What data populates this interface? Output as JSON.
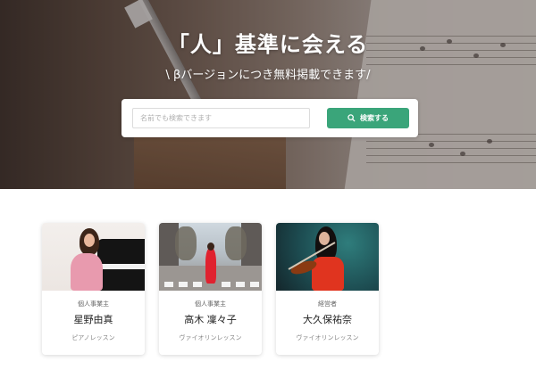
{
  "hero": {
    "title": "「人」基準に会える",
    "subtitle": "\\ βバージョンにつき無料掲載できます/"
  },
  "search": {
    "placeholder": "名前でも検索できます",
    "button_label": "検索する",
    "button_icon": "search-icon",
    "button_color": "#3aa57a"
  },
  "cards": [
    {
      "role": "個人事業主",
      "name": "星野由真",
      "lesson": "ピアノレッスン",
      "photo": "pianist-photo"
    },
    {
      "role": "個人事業主",
      "name": "高木 凜々子",
      "lesson": "ヴァイオリンレッスン",
      "photo": "street-violinist-photo"
    },
    {
      "role": "経営者",
      "name": "大久保祐奈",
      "lesson": "ヴァイオリンレッスン",
      "photo": "violinist-photo"
    }
  ]
}
